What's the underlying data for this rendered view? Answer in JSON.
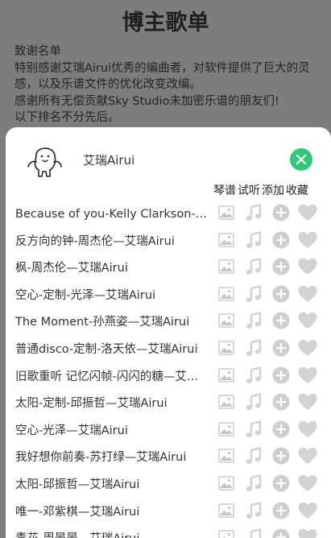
{
  "page": {
    "title": "博主歌单",
    "thanks_lines": [
      "致谢名单",
      "特别感谢艾瑞Airui优秀的编曲者，对软件提供了巨大的灵",
      "感，以及乐谱文件的优化改变改编。",
      "感谢所有无偿贡献Sky Studio未加密乐谱的朋友们!",
      "以下排名不分先后。"
    ]
  },
  "sheet": {
    "author_name": "艾瑞Airui",
    "avatar_icon": "cartoon-avatar-icon",
    "close_icon": "close-icon",
    "accent_color": "#34c77a",
    "columns": [
      "琴谱",
      "试听",
      "添加",
      "收藏"
    ],
    "row_icons": [
      "image-icon",
      "music-note-icon",
      "plus-circle-icon",
      "heart-icon"
    ],
    "songs": [
      "Because of you-Kelly Clarkson-艾瑞Airui",
      "反方向的钟-周杰伦—艾瑞Airui",
      "枫-周杰伦—艾瑞Airui",
      "空心-定制-光泽—艾瑞Airui",
      "The Moment-孙燕姿—艾瑞Airui",
      "普通disco-定制-洛天依—艾瑞Airui",
      "旧歌重听 记忆闪帧-闪闪的糖—艾瑞Airui",
      "太阳-定制-邱振哲—艾瑞Airui",
      "空心-光泽—艾瑞Airui",
      "我好想你前奏-苏打绿—艾瑞Airui",
      "太阳-邱振哲—艾瑞Airui",
      "唯一-邓紫棋—艾瑞Airui",
      "青花-周晏晏—艾瑞Airui"
    ]
  }
}
